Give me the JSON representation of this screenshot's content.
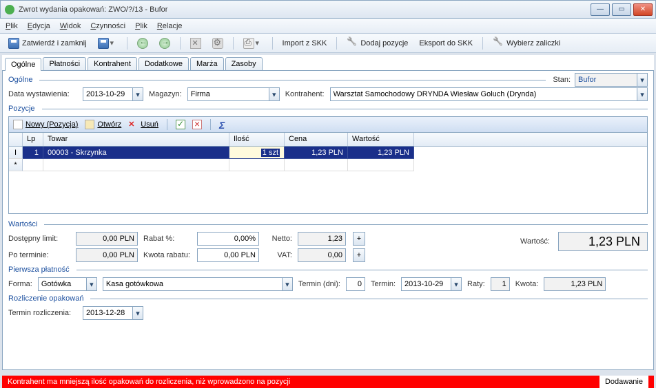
{
  "window": {
    "title": "Zwrot wydania opakowań: ZWO/?/13 - Bufor"
  },
  "menu": {
    "plik": "Plik",
    "edycja": "Edycja",
    "widok": "Widok",
    "czynnosci": "Czynności",
    "plik2": "Plik",
    "relacje": "Relacje"
  },
  "toolbar": {
    "zatwierdz": "Zatwierdź i zamknij",
    "import": "Import z SKK",
    "dodaj": "Dodaj pozycje",
    "eksport": "Eksport do SKK",
    "wybierz": "Wybierz zaliczki"
  },
  "tabs": {
    "ogolne": "Ogólne",
    "platnosci": "Płatności",
    "kontrahent": "Kontrahent",
    "dodatkowe": "Dodatkowe",
    "marza": "Marża",
    "zasoby": "Zasoby"
  },
  "ogolne": {
    "label": "Ogólne",
    "stan_lbl": "Stan:",
    "stan_val": "Bufor",
    "data_lbl": "Data wystawienia:",
    "data_val": "2013-10-29",
    "mag_lbl": "Magazyn:",
    "mag_val": "Firma",
    "kontr_lbl": "Kontrahent:",
    "kontr_val": "Warsztat Samochodowy DRYNDA Wiesław Goluch  (Drynda)"
  },
  "pozycje": {
    "label": "Pozycje",
    "nowy": "Nowy (Pozycja)",
    "otworz": "Otwórz",
    "usun": "Usuń",
    "headers": {
      "lp": "Lp",
      "towar": "Towar",
      "ilosc": "Ilość",
      "cena": "Cena",
      "wartosc": "Wartość"
    },
    "rows": [
      {
        "lp": "1",
        "towar": "00003 - Skrzynka",
        "ilosc": "1 szt",
        "cena": "1,23 PLN",
        "wartosc": "1,23 PLN"
      }
    ]
  },
  "wartosci": {
    "label": "Wartości",
    "limit_lbl": "Dostępny limit:",
    "limit": "0,00 PLN",
    "poterm_lbl": "Po terminie:",
    "poterm": "0,00 PLN",
    "rabat_lbl": "Rabat %:",
    "rabat": "0,00%",
    "krabat_lbl": "Kwota rabatu:",
    "krabat": "0,00 PLN",
    "netto_lbl": "Netto:",
    "netto": "1,23",
    "vat_lbl": "VAT:",
    "vat": "0,00",
    "wartosc_lbl": "Wartość:",
    "wartosc": "1,23 PLN"
  },
  "platnosc": {
    "label": "Pierwsza płatność",
    "forma_lbl": "Forma:",
    "forma": "Gotówka",
    "kasa": "Kasa gotówkowa",
    "termdni_lbl": "Termin (dni):",
    "termdni": "0",
    "termin_lbl": "Termin:",
    "termin": "2013-10-29",
    "raty_lbl": "Raty:",
    "raty": "1",
    "kwota_lbl": "Kwota:",
    "kwota": "1,23 PLN"
  },
  "rozliczenie": {
    "label": "Rozliczenie opakowań",
    "termin_lbl": "Termin rozliczenia:",
    "termin": "2013-12-28"
  },
  "status": {
    "error": "Kontrahent ma mniejszą ilość opakowań do rozliczenia, niż wprowadzono na pozycji",
    "mode": "Dodawanie"
  }
}
